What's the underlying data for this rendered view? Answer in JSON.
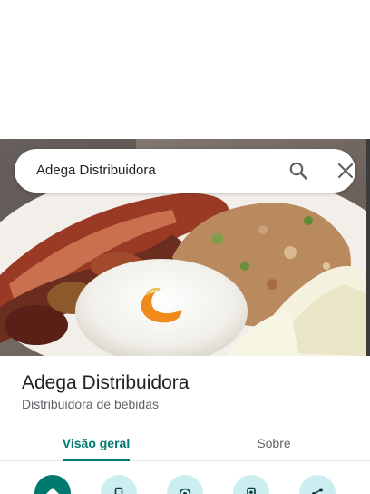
{
  "search": {
    "query": "Adega Distribuidora",
    "search_icon": "search-icon",
    "close_icon": "close-icon"
  },
  "hero": {
    "image": "photo of food plate: meat skewers, white rice with pepper, farofa and cassava"
  },
  "place": {
    "title": "Adega Distribuidora",
    "category": "Distribuidora de bebidas"
  },
  "tabs": [
    {
      "label": "Visão geral",
      "selected": true
    },
    {
      "label": "Sobre",
      "selected": false
    }
  ],
  "actions": [
    {
      "icon": "directions-icon"
    },
    {
      "icon": "phone-icon"
    },
    {
      "icon": "nearby-icon"
    },
    {
      "icon": "send-to-phone-icon"
    },
    {
      "icon": "share-icon"
    }
  ],
  "colors": {
    "accent": "#01796f",
    "action_bg": "#cdeef0",
    "title": "#202124",
    "secondary": "#5f6368"
  }
}
